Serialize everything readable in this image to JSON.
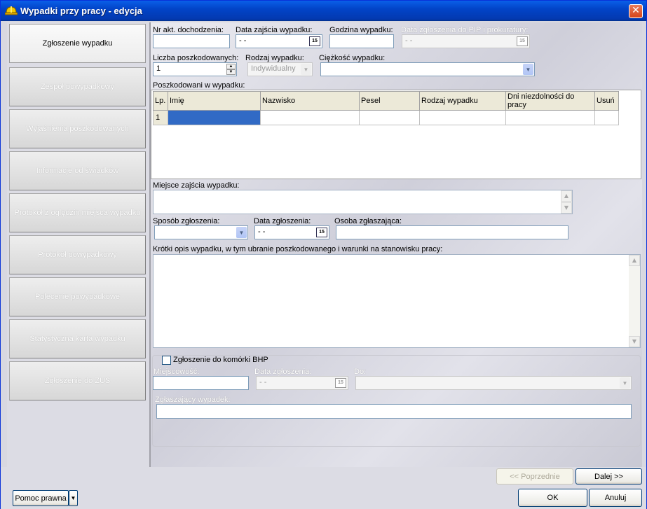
{
  "window": {
    "title": "Wypadki przy pracy - edycja",
    "close_glyph": "✕"
  },
  "nav": {
    "items": [
      {
        "label": "Zgłoszenie wypadku",
        "active": true
      },
      {
        "label": "Zespół powypadkowy"
      },
      {
        "label": "Wyjaśnienia poszkodowanych"
      },
      {
        "label": "Informacje od świadków"
      },
      {
        "label": "Protokół z oględzin miejsca wypadku"
      },
      {
        "label": "Protokół powypadkowy"
      },
      {
        "label": "Polecenie powypadkowe"
      },
      {
        "label": "Statystyczna karta wypadku"
      },
      {
        "label": "Zgłoszenie do ZUS"
      }
    ]
  },
  "form": {
    "nr_akt_label": "Nr akt. dochodzenia:",
    "nr_akt_value": "",
    "data_zajscia_label": "Data zajścia wypadku:",
    "data_zajscia_value": "  -  -",
    "godzina_label": "Godzina wypadku:",
    "godzina_value": "",
    "data_pip_label": "Data zgłoszenia do PIP i prokuratury:",
    "data_pip_value": "  -  -",
    "liczba_label": "Liczba poszkodowanych:",
    "liczba_value": "1",
    "rodzaj_label": "Rodzaj wypadku:",
    "rodzaj_value": "Indywidualny",
    "ciezkosc_label": "Ciężkość wypadku:",
    "ciezkosc_value": "",
    "poszkodowani_label": "Poszkodowani w wypadku:",
    "miejsce_label": "Miejsce zajścia wypadku:",
    "sposob_label": "Sposób zgłoszenia:",
    "sposob_value": "",
    "data_zgl_label": "Data zgłoszenia:",
    "data_zgl_value": "  -  -",
    "osoba_label": "Osoba zgłaszająca:",
    "osoba_value": "",
    "opis_label": "Krótki opis wypadku, w tym ubranie poszkodowanego i warunki na stanowisku pracy:",
    "calendar_glyph": "15"
  },
  "table": {
    "columns": [
      "Lp.",
      "Imię",
      "Nazwisko",
      "Pesel",
      "Rodzaj wypadku",
      "Dni niezdolności do pracy",
      "Usuń"
    ],
    "rows": [
      [
        "1",
        "",
        "",
        "",
        "",
        "",
        ""
      ]
    ]
  },
  "bhp": {
    "checkbox_label": "Zgłoszenie do komórki BHP",
    "checked": false,
    "miejscowosc_label": "Miejscowość:",
    "data_label": "Data zgłoszenia:",
    "data_value": "  -  -",
    "do_label": "Do:",
    "zglaszajacy_label": "Zgłaszający wypadek:"
  },
  "buttons": {
    "prev": "<< Poprzednie",
    "next": "Dalej >>",
    "ok": "OK",
    "cancel": "Anuluj",
    "help": "Pomoc prawna"
  },
  "colors": {
    "selection": "#316ac5",
    "titlebar": "#0244c8",
    "close": "#d7441a"
  }
}
